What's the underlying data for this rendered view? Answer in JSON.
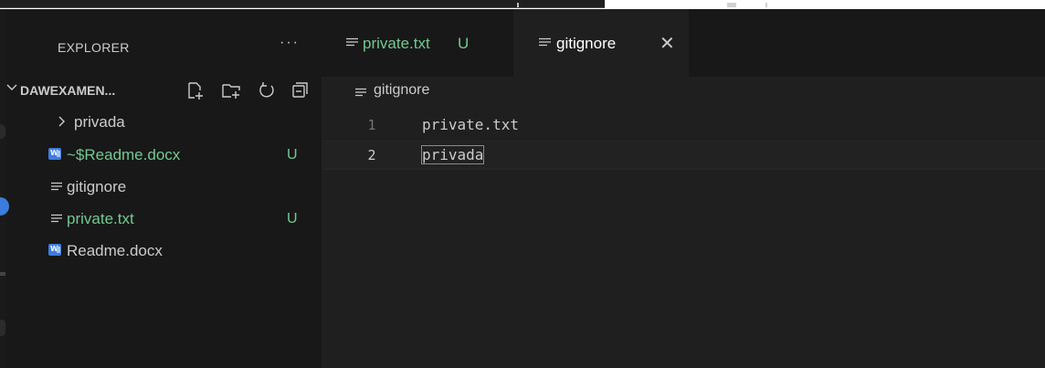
{
  "sidebar": {
    "title": "EXPLORER",
    "more": "···",
    "section_title": "DAWEXAMEN...",
    "items": [
      {
        "label": "privada",
        "type": "folder",
        "badge": "",
        "color": "#cccccc"
      },
      {
        "label": "~$Readme.docx",
        "type": "word",
        "badge": "U",
        "color": "#73c991"
      },
      {
        "label": "gitignore",
        "type": "text",
        "badge": "",
        "color": "#cccccc"
      },
      {
        "label": "private.txt",
        "type": "text",
        "badge": "U",
        "color": "#73c991"
      },
      {
        "label": "Readme.docx",
        "type": "word",
        "badge": "",
        "color": "#cccccc"
      }
    ]
  },
  "tabs": [
    {
      "label": "private.txt",
      "badge": "U",
      "active": false
    },
    {
      "label": "gitignore",
      "close": "✕",
      "active": true
    }
  ],
  "editor": {
    "breadcrumb": "gitignore",
    "lines": [
      {
        "number": "1",
        "text": "private.txt"
      },
      {
        "number": "2",
        "text": "privada"
      }
    ]
  },
  "icons": {
    "word_badge": "W"
  },
  "colors": {
    "untracked": "#73c991",
    "accent": "#3b7ddd",
    "background": "#181818",
    "editor_bg": "#1f1f1f"
  }
}
